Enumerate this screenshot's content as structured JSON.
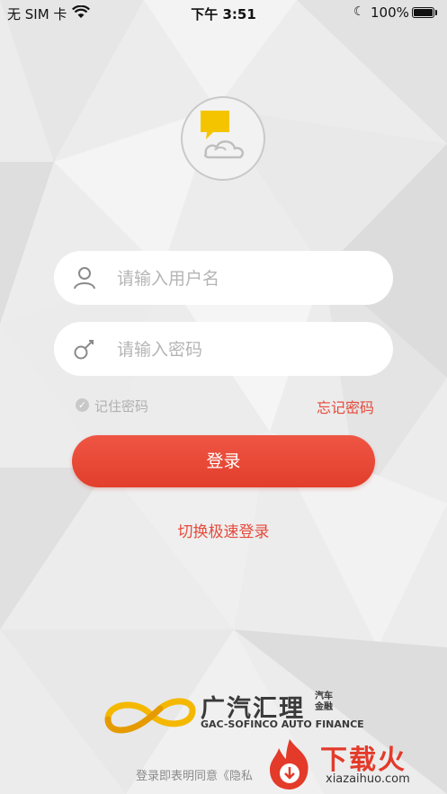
{
  "status_bar": {
    "carrier": "无 SIM 卡",
    "time": "下午 3:51",
    "battery": "100%"
  },
  "login": {
    "username_placeholder": "请输入用户名",
    "password_placeholder": "请输入密码",
    "remember_label": "记住密码",
    "forgot_label": "忘记密码",
    "submit_label": "登录",
    "quick_login_label": "切换极速登录"
  },
  "brand": {
    "name_cn": "广汽汇理",
    "name_cn_small": "汽车金融",
    "name_en": "GAC-SOFINCO AUTO FINANCE"
  },
  "footer": {
    "agreement_text": "登录即表明同意《隐私"
  },
  "watermark": {
    "title": "下载火",
    "domain": "xiazaihuo.com"
  },
  "colors": {
    "accent": "#e64a3b",
    "button": "#e84634",
    "logo_yellow": "#f5c400"
  },
  "icons": {
    "user": "user-icon",
    "key": "key-icon",
    "checkmark": "check-circle-icon"
  }
}
